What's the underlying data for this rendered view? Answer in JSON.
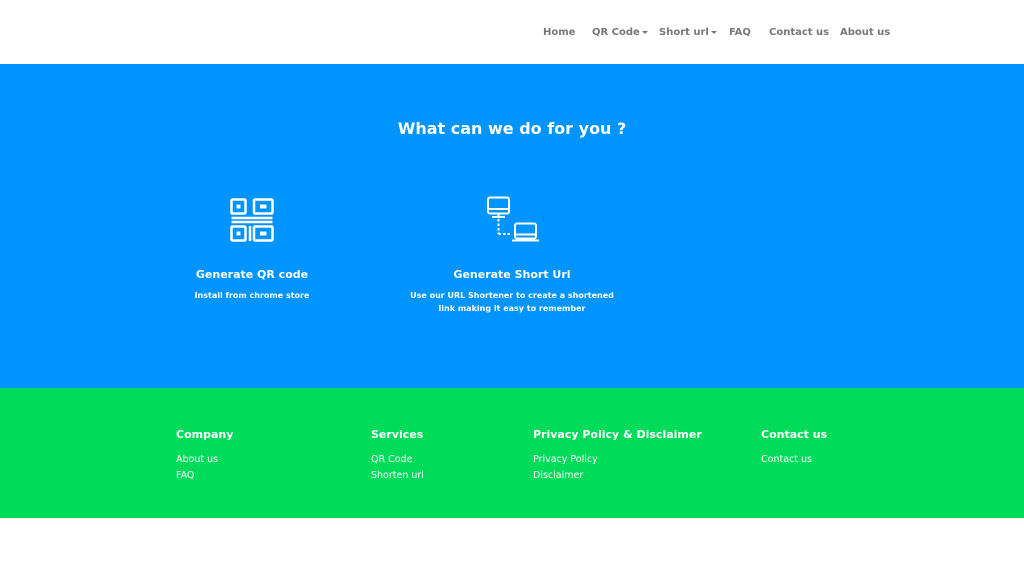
{
  "nav": {
    "items": [
      {
        "label": "Home"
      },
      {
        "label": "QR Code"
      },
      {
        "label": "Short url"
      },
      {
        "label": "FAQ"
      },
      {
        "label": "Contact us"
      },
      {
        "label": "About us"
      }
    ]
  },
  "hero": {
    "title": "What can we do for you ?",
    "services": [
      {
        "icon": "qr-code-icon",
        "title": "Generate QR code",
        "description": "Install from chrome store"
      },
      {
        "icon": "network-link-icon",
        "title": "Generate Short Url",
        "description": "Use our URL Shortener to create a shortened link making it easy to remember"
      }
    ]
  },
  "footer": {
    "columns": [
      {
        "heading": "Company",
        "links": [
          "About us",
          "FAQ"
        ]
      },
      {
        "heading": "Services",
        "links": [
          "QR Code",
          "Shorten url"
        ]
      },
      {
        "heading": "Privacy Policy & Disclaimer",
        "links": [
          "Privacy Policy",
          "Disclaimer"
        ]
      },
      {
        "heading": "Contact us",
        "links": [
          "Contact us"
        ]
      }
    ]
  },
  "colors": {
    "hero_background": "#0094fe",
    "footer_background": "#00dc5a",
    "nav_text": "#777777",
    "text_on_color": "#ffffff"
  }
}
